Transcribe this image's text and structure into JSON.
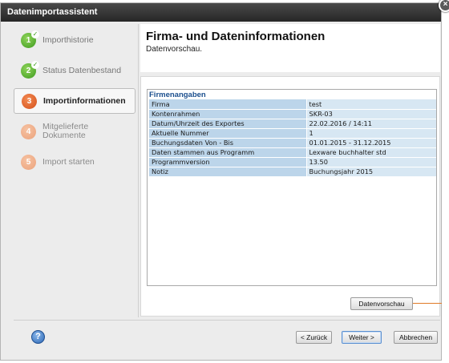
{
  "window": {
    "title": "Datenimportassistent",
    "close_glyph": "×"
  },
  "steps": [
    {
      "number": "1",
      "label": "Importhistorie",
      "state": "done"
    },
    {
      "number": "2",
      "label": "Status Datenbestand",
      "state": "done"
    },
    {
      "number": "3",
      "label": "Importinformationen",
      "state": "active"
    },
    {
      "number": "4",
      "label": "Mitgelieferte Dokumente",
      "state": "pending"
    },
    {
      "number": "5",
      "label": "Import starten",
      "state": "pending"
    }
  ],
  "header": {
    "title": "Firma- und Dateninformationen",
    "subtitle": "Datenvorschau."
  },
  "panel": {
    "heading": "Firmenangaben",
    "rows": [
      {
        "key": "Firma",
        "value": "test"
      },
      {
        "key": "Kontenrahmen",
        "value": "SKR-03"
      },
      {
        "key": "Datum/Uhrzeit des Exportes",
        "value": "22.02.2016 / 14:11"
      },
      {
        "key": "Aktuelle Nummer",
        "value": "1"
      },
      {
        "key": "Buchungsdaten Von - Bis",
        "value": "01.01.2015 - 31.12.2015"
      },
      {
        "key": "Daten stammen aus Programm",
        "value": "Lexware buchhalter std"
      },
      {
        "key": "Programmversion",
        "value": "13.50"
      },
      {
        "key": "Notiz",
        "value": "Buchungsjahr 2015"
      }
    ]
  },
  "buttons": {
    "preview": "Datenvorschau",
    "back": "< Zurück",
    "next": "Weiter >",
    "cancel": "Abbrechen"
  },
  "icons": {
    "help": "?",
    "check": "✓"
  },
  "colors": {
    "done": "#3d9a1e",
    "active": "#d4501b",
    "pending": "#eba27b",
    "accent": "#1b4f8e"
  }
}
